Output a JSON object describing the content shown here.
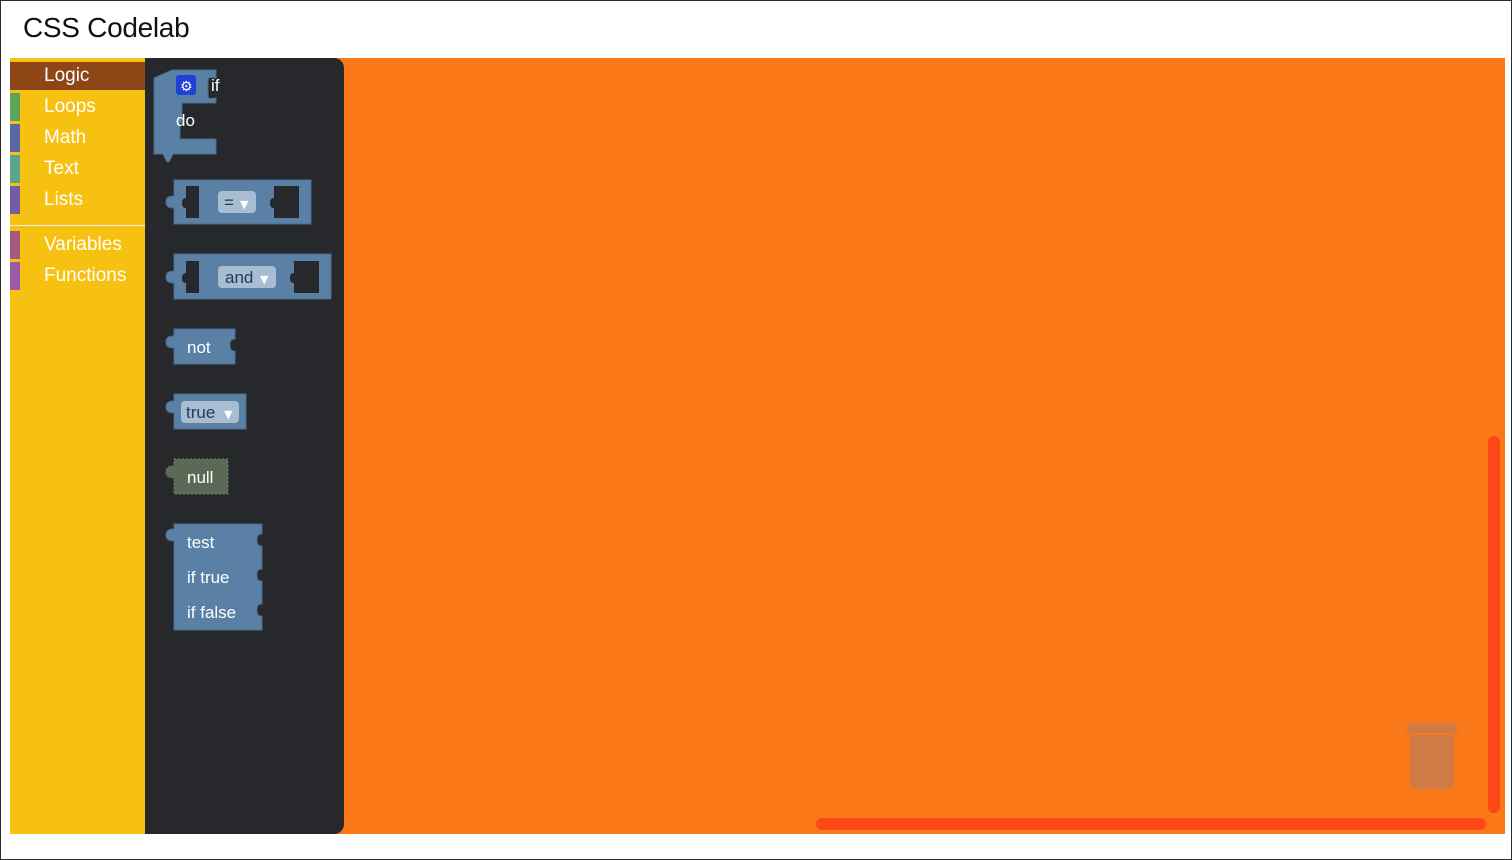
{
  "page": {
    "title": "CSS Codelab"
  },
  "toolbox": {
    "categories": [
      {
        "label": "Logic",
        "color": "#8e4617",
        "selected": true
      },
      {
        "label": "Loops",
        "color": "#5ba55b"
      },
      {
        "label": "Math",
        "color": "#5b67a5"
      },
      {
        "label": "Text",
        "color": "#5ba58c"
      },
      {
        "label": "Lists",
        "color": "#745ba5"
      },
      {
        "label": "Variables",
        "color": "#a55b80"
      },
      {
        "label": "Functions",
        "color": "#995ba5"
      }
    ]
  },
  "flyout": {
    "if_block": {
      "if": "if",
      "do": "do"
    },
    "compare_block": {
      "operator": "="
    },
    "operation_block": {
      "operator": "and"
    },
    "negate_block": {
      "label": "not"
    },
    "boolean_block": {
      "value": "true"
    },
    "null_block": {
      "label": "null"
    },
    "ternary_block": {
      "test": "test",
      "if_true": "if true",
      "if_false": "if false"
    }
  },
  "colors": {
    "workspace": "#fb7819",
    "toolbox": "#f7c111",
    "flyout": "#26282b",
    "block": "#5b80a5",
    "scrollbar": "#fc4816"
  }
}
